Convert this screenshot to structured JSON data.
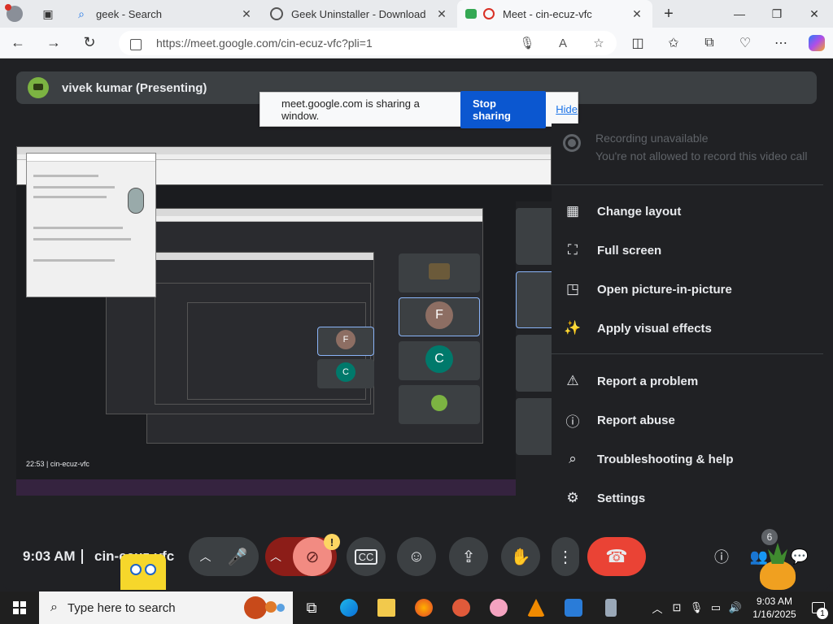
{
  "browser": {
    "tabs": [
      {
        "title": "geek - Search",
        "icon": "search-icon"
      },
      {
        "title": "Geek Uninstaller - Download",
        "icon": "globe-icon"
      },
      {
        "title": "Meet - cin-ecuz-vfc",
        "icon": "meet-icon",
        "active": true
      }
    ],
    "new_tab_label": "+",
    "url": "https://meet.google.com/cin-ecuz-vfc?pli=1"
  },
  "meet": {
    "presenter_label": "vivek kumar (Presenting)",
    "sharing_bar": {
      "text": "meet.google.com is sharing a window.",
      "stop_label": "Stop sharing",
      "hide_label": "Hide"
    },
    "menu": {
      "recording_title": "Recording unavailable",
      "recording_sub": "You're not allowed to record this video call",
      "items": [
        {
          "label": "Change layout",
          "icon": "layout-icon"
        },
        {
          "label": "Full screen",
          "icon": "fullscreen-icon"
        },
        {
          "label": "Open picture-in-picture",
          "icon": "pip-icon"
        },
        {
          "label": "Apply visual effects",
          "icon": "visual-effects-icon"
        },
        {
          "label": "Report a problem",
          "icon": "feedback-icon"
        },
        {
          "label": "Report abuse",
          "icon": "report-abuse-icon"
        },
        {
          "label": "Troubleshooting & help",
          "icon": "help-icon"
        },
        {
          "label": "Settings",
          "icon": "gear-icon"
        }
      ]
    },
    "controls": {
      "time": "9:03 AM",
      "meeting_code": "cin-ecuz-vfc",
      "warning_badge": "!",
      "participant_count": "6"
    },
    "thumbnails": {
      "tile_letters": [
        "F",
        "C",
        "F",
        "C"
      ],
      "mini_clock": "22:53 | cin-ecuz-vfc"
    },
    "colors": {
      "background": "#202124",
      "surface": "#3c4043",
      "end_call": "#ea4335",
      "camera_off": "#f28b82",
      "accent_blue": "#0b57d0"
    }
  },
  "taskbar": {
    "search_placeholder": "Type here to search",
    "time": "9:03 AM",
    "date": "1/16/2025",
    "notification_count": "1"
  }
}
